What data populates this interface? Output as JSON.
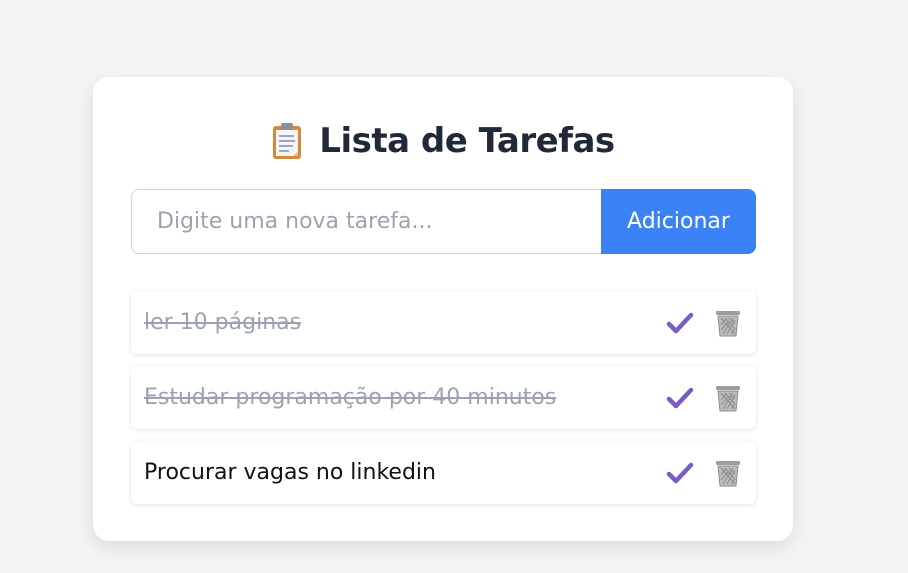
{
  "header": {
    "icon": "clipboard-icon",
    "title": "Lista de Tarefas"
  },
  "form": {
    "input_value": "",
    "input_placeholder": "Digite uma nova tarefa...",
    "add_label": "Adicionar"
  },
  "tasks": [
    {
      "text": "ler 10 páginas",
      "done": true,
      "complete_icon": "check-icon",
      "delete_icon": "trash-icon"
    },
    {
      "text": "Estudar programação por 40 minutos",
      "done": true,
      "complete_icon": "check-icon",
      "delete_icon": "trash-icon"
    },
    {
      "text": "Procurar vagas no linkedin",
      "done": false,
      "complete_icon": "check-icon",
      "delete_icon": "trash-icon"
    }
  ],
  "colors": {
    "accent": "#3b82f6",
    "check": "#7c5cc4",
    "trash": "#9e9e9e",
    "done_text": "#9ca3af"
  }
}
